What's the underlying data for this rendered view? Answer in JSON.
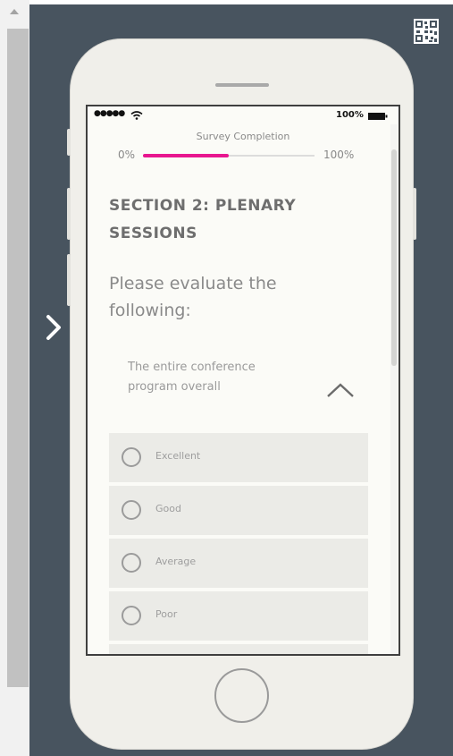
{
  "survey": {
    "progress": {
      "title": "Survey Completion",
      "min_label": "0%",
      "max_label": "100%",
      "completion_fraction": 0.5
    },
    "section_title": "SECTION 2:  PLENARY SESSIONS",
    "instruction": "Please evaluate the following:",
    "question": "The entire conference program overall",
    "options": [
      {
        "label": "Excellent"
      },
      {
        "label": "Good"
      },
      {
        "label": "Average"
      },
      {
        "label": "Poor"
      },
      {
        "label": ""
      }
    ]
  },
  "status_bar": {
    "signal": "●●●●●",
    "battery_pct": "100%"
  },
  "icons": {
    "qr": "qr-code-icon",
    "next": "chevron-right-icon",
    "collapse": "chevron-up-icon",
    "wifi": "wifi-icon",
    "battery": "battery-icon"
  },
  "colors": {
    "stage_background": "#48545f",
    "progress_accent": "#e8168f",
    "phone_body": "#f0efea"
  }
}
